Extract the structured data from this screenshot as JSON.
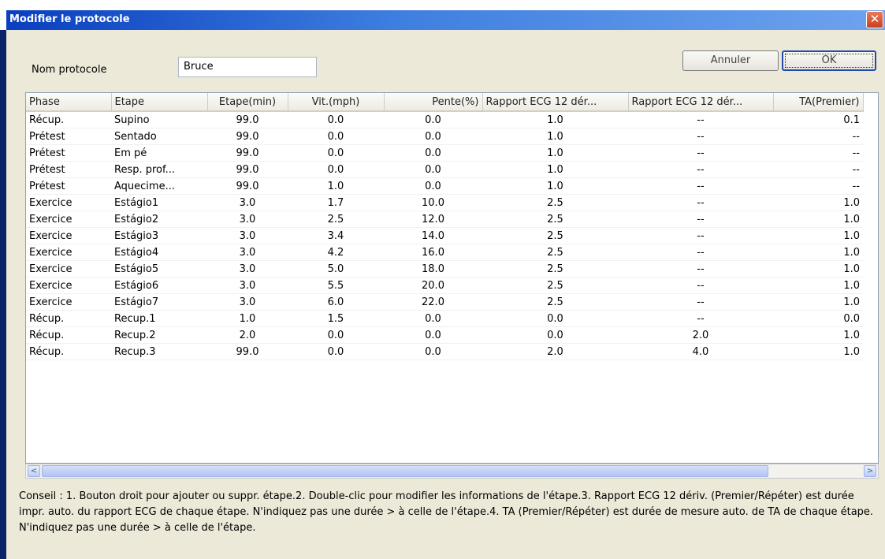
{
  "window": {
    "title": "Modifier le protocole",
    "close_glyph": "✕"
  },
  "form": {
    "name_label": "Nom protocole",
    "name_value": "Bruce"
  },
  "buttons": {
    "cancel": "Annuler",
    "ok": "OK"
  },
  "table": {
    "columns": [
      "Phase",
      "Etape",
      "Etape(min)",
      "Vit.(mph)",
      "Pente(%)",
      "Rapport ECG 12 dér...",
      "Rapport ECG 12 dér...",
      "TA(Premier)"
    ],
    "rows": [
      [
        "Récup.",
        "Supino",
        "99.0",
        "0.0",
        "0.0",
        "1.0",
        "--",
        "0.1"
      ],
      [
        "Prétest",
        "Sentado",
        "99.0",
        "0.0",
        "0.0",
        "1.0",
        "--",
        "--"
      ],
      [
        "Prétest",
        "Em pé",
        "99.0",
        "0.0",
        "0.0",
        "1.0",
        "--",
        "--"
      ],
      [
        "Prétest",
        "Resp. prof...",
        "99.0",
        "0.0",
        "0.0",
        "1.0",
        "--",
        "--"
      ],
      [
        "Prétest",
        "Aquecime...",
        "99.0",
        "1.0",
        "0.0",
        "1.0",
        "--",
        "--"
      ],
      [
        "Exercice",
        "Estágio1",
        "3.0",
        "1.7",
        "10.0",
        "2.5",
        "--",
        "1.0"
      ],
      [
        "Exercice",
        "Estágio2",
        "3.0",
        "2.5",
        "12.0",
        "2.5",
        "--",
        "1.0"
      ],
      [
        "Exercice",
        "Estágio3",
        "3.0",
        "3.4",
        "14.0",
        "2.5",
        "--",
        "1.0"
      ],
      [
        "Exercice",
        "Estágio4",
        "3.0",
        "4.2",
        "16.0",
        "2.5",
        "--",
        "1.0"
      ],
      [
        "Exercice",
        "Estágio5",
        "3.0",
        "5.0",
        "18.0",
        "2.5",
        "--",
        "1.0"
      ],
      [
        "Exercice",
        "Estágio6",
        "3.0",
        "5.5",
        "20.0",
        "2.5",
        "--",
        "1.0"
      ],
      [
        "Exercice",
        "Estágio7",
        "3.0",
        "6.0",
        "22.0",
        "2.5",
        "--",
        "1.0"
      ],
      [
        "Récup.",
        "Recup.1",
        "1.0",
        "1.5",
        "0.0",
        "0.0",
        "--",
        "0.0"
      ],
      [
        "Récup.",
        "Recup.2",
        "2.0",
        "0.0",
        "0.0",
        "0.0",
        "2.0",
        "1.0"
      ],
      [
        "Récup.",
        "Recup.3",
        "99.0",
        "0.0",
        "0.0",
        "2.0",
        "4.0",
        "1.0"
      ]
    ]
  },
  "scrollbar": {
    "left_arrow": "<",
    "right_arrow": ">",
    "grip": "III"
  },
  "hint": "Conseil : 1. Bouton droit pour ajouter ou suppr. étape.2. Double-clic pour modifier les informations de l'étape.3.  Rapport ECG 12 dériv. (Premier/Répéter) est durée impr. auto. du rapport ECG de chaque étape. N'indiquez pas une durée > à celle de l'étape.4. TA (Premier/Répéter) est durée de mesure auto. de TA de chaque étape. N'indiquez pas une durée > à celle de l'étape."
}
